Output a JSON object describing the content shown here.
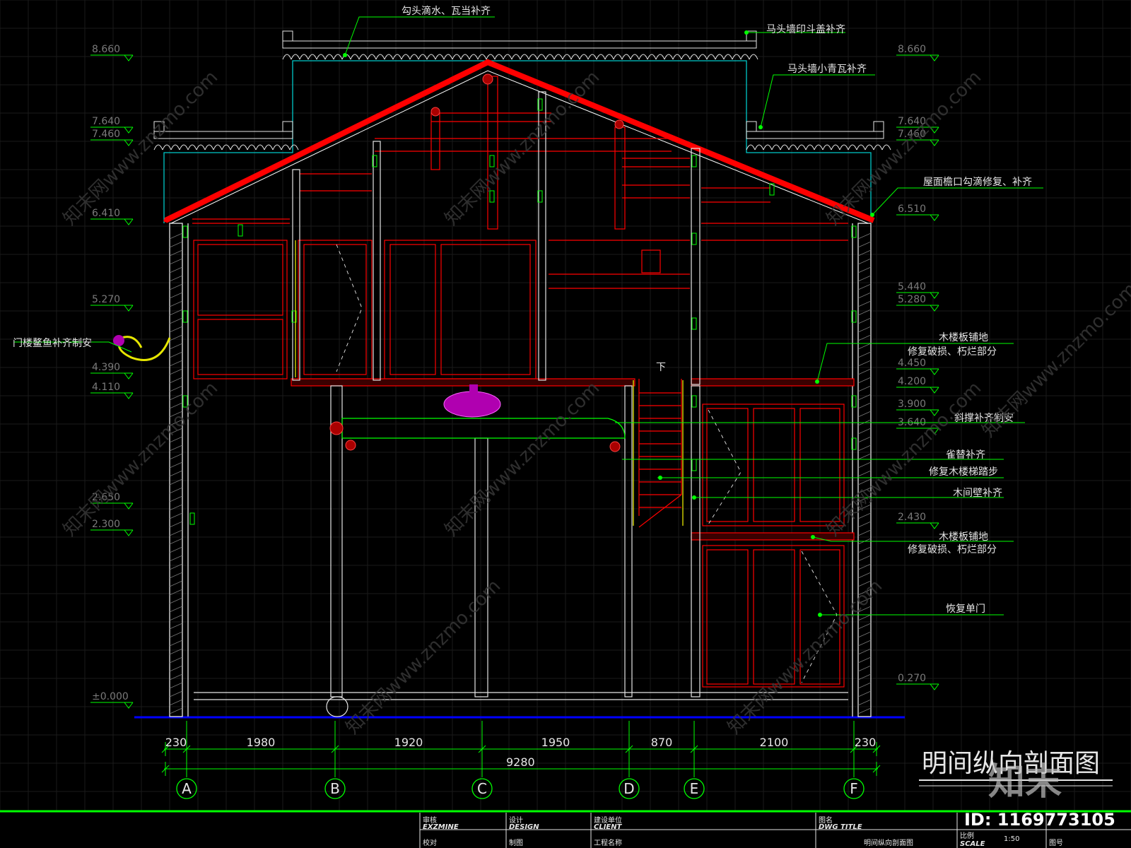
{
  "drawing": {
    "title": "明间纵向剖面图",
    "id_label": "ID: 1169773105",
    "colors": {
      "background": "#000000",
      "grid": "#1c1c1c",
      "cad_green": "#00ff00",
      "cad_red": "#ff0000",
      "cad_white": "#e6e6e6",
      "cad_cyan": "#00c8c8",
      "cad_magenta": "#d400d4",
      "cad_blue": "#0000ff",
      "cad_yellow": "#e6e600",
      "watermark": "#3a3a3a"
    }
  },
  "left_elevations": [
    "8.660",
    "7.640",
    "7.460",
    "6.410",
    "5.270",
    "4.390",
    "4.110",
    "2.650",
    "2.300",
    "±0.000"
  ],
  "right_elevations": [
    "8.660",
    "7.640",
    "7.460",
    "6.510",
    "5.440",
    "5.280",
    "4.450",
    "4.200",
    "3.900",
    "3.640",
    "2.430",
    "0.270"
  ],
  "annotations": {
    "top": "勾头滴水、瓦当补齐",
    "stamp": "马头墙印斗盖补齐",
    "small_tile": "马头墙小青瓦补齐",
    "eave": "屋面檐口勾滴修复、补齐",
    "fish": "门楼鳌鱼补齐制安",
    "floor1_a": "木楼板铺地",
    "floor1_b": "修复破损、朽烂部分",
    "brace": "斜撑补齐制安",
    "bracket": "雀替补齐",
    "stair": "修复木楼梯踏步",
    "partition": "木间壁补齐",
    "floor2_a": "木楼板铺地",
    "floor2_b": "修复破损、朽烂部分",
    "door": "恢复单门",
    "down": "下"
  },
  "dimensions": {
    "segments": [
      "230",
      "1980",
      "1920",
      "1950",
      "870",
      "2100",
      "230"
    ],
    "total": "9280"
  },
  "axes": [
    "A",
    "B",
    "C",
    "D",
    "E",
    "F"
  ],
  "title_block": {
    "review": "审核",
    "review_en": "EXZMINE",
    "check": "校对",
    "design": "设计",
    "design_en": "DESIGN",
    "draw": "制图",
    "client": "建设单位",
    "client_en": "CLIENT",
    "project": "工程名称",
    "dwg": "图名",
    "dwg_en": "DWG TITLE",
    "dwg_value": "明间纵向剖面图",
    "scale": "比例",
    "scale_en": "SCALE",
    "scale_value": "1:50",
    "sheet_no": "图号"
  },
  "watermarks": [
    "知末网www.znzmo.com",
    "知末"
  ]
}
